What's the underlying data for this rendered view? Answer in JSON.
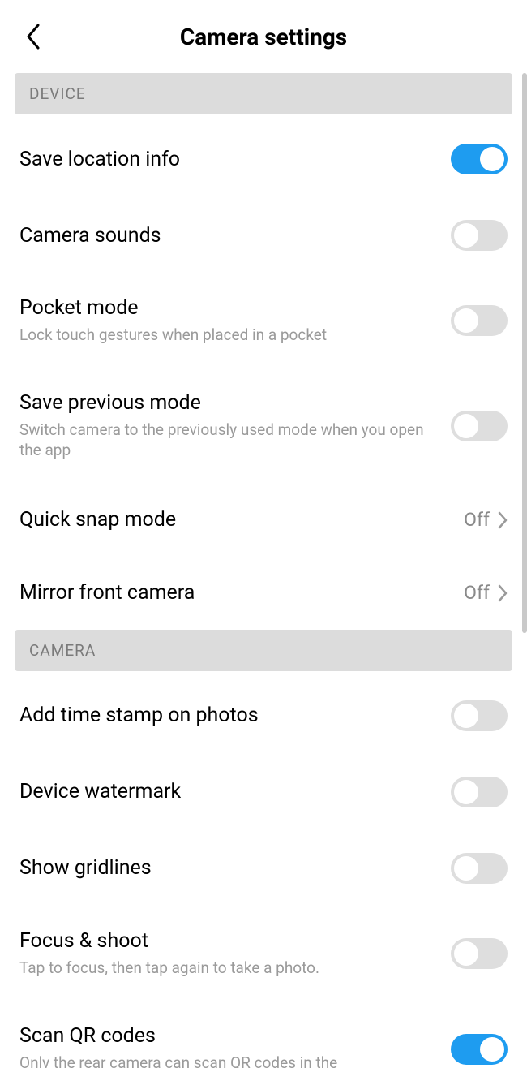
{
  "header": {
    "title": "Camera settings"
  },
  "sections": {
    "device": {
      "label": "DEVICE",
      "save_location": {
        "title": "Save location info",
        "on": true
      },
      "camera_sounds": {
        "title": "Camera sounds",
        "on": false
      },
      "pocket_mode": {
        "title": "Pocket mode",
        "desc": "Lock touch gestures when placed in a pocket",
        "on": false
      },
      "save_prev_mode": {
        "title": "Save previous mode",
        "desc": "Switch camera to the previously used mode when you open the app",
        "on": false
      },
      "quick_snap": {
        "title": "Quick snap mode",
        "value": "Off"
      },
      "mirror_front": {
        "title": "Mirror front camera",
        "value": "Off"
      }
    },
    "camera": {
      "label": "CAMERA",
      "timestamp": {
        "title": "Add time stamp on photos",
        "on": false
      },
      "watermark": {
        "title": "Device watermark",
        "on": false
      },
      "gridlines": {
        "title": "Show gridlines",
        "on": false
      },
      "focus_shoot": {
        "title": "Focus & shoot",
        "desc": "Tap to focus, then tap again to take a photo.",
        "on": false
      },
      "scan_qr": {
        "title": "Scan QR codes",
        "desc": "Only the rear camera can scan QR codes in the",
        "on": true
      }
    }
  }
}
